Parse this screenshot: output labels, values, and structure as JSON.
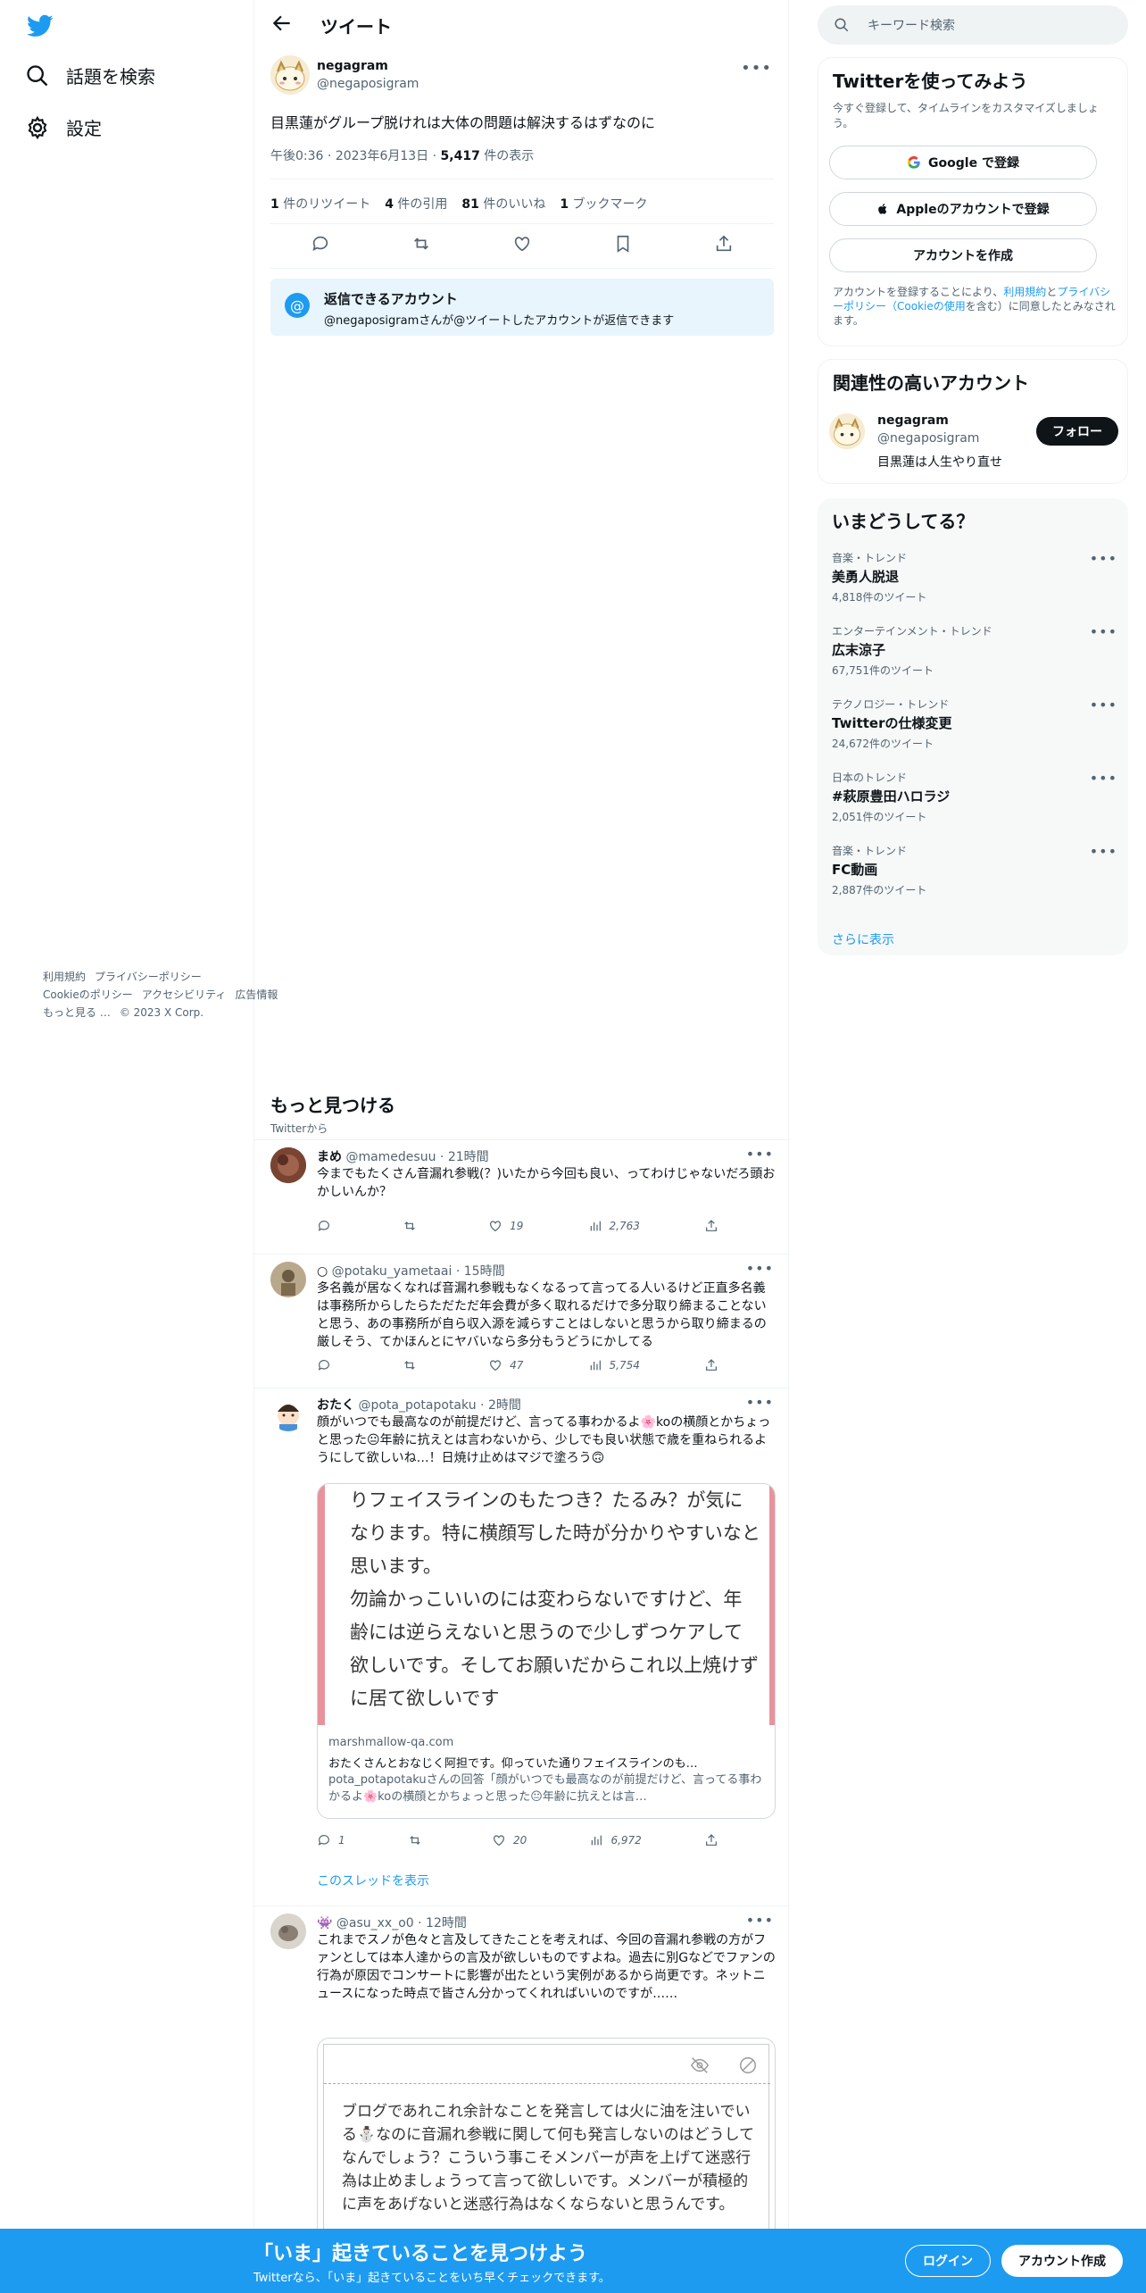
{
  "nav": {
    "explore_label": "話題を検索",
    "settings_label": "設定"
  },
  "header": {
    "title": "ツイート"
  },
  "tweet": {
    "name": "negagram",
    "handle": "@negaposigram",
    "text": "目黒蓮がグループ脱けれは大体の問題は解決するはずなのに",
    "time": "午後0:36",
    "date": "2023年6月13日",
    "views": "5,417",
    "views_label": "件の表示",
    "retweets": "1",
    "retweets_label": "件のリツイート",
    "quotes": "4",
    "quotes_label": "件の引用",
    "likes": "81",
    "likes_label": "件のいいね",
    "bookmarks": "1",
    "bookmarks_label": "ブックマーク"
  },
  "reply_notice": {
    "title": "返信できるアカウント",
    "body": "@negaposigramさんが@ツイートしたアカウントが返信できます"
  },
  "discover": {
    "title": "もっと見つける",
    "subtitle": "Twitterから"
  },
  "posts": [
    {
      "name": "まめ",
      "handle": "@mamedesuu",
      "time": "21時間",
      "text": "今までもたくさん音漏れ参戦(？)いたから今回も良い、ってわけじゃないだろ頭おかしいんか？",
      "replies": "",
      "retweets": "",
      "likes": "19",
      "views": "2,763"
    },
    {
      "name": "○",
      "handle": "@potaku_yametaai",
      "time": "15時間",
      "text": "多名義が居なくなれば音漏れ参戦もなくなるって言ってる人いるけど正直多名義は事務所からしたらただただ年会費が多く取れるだけで多分取り締まることないと思う、あの事務所が自ら収入源を減らすことはしないと思うから取り締まるの厳しそう、てかほんとにヤバいなら多分もうどうにかしてる",
      "replies": "",
      "retweets": "",
      "likes": "47",
      "views": "5,754"
    },
    {
      "name": "おたく",
      "handle": "@pota_potapotaku",
      "time": "2時間",
      "text": "顔がいつでも最高なのが前提だけど、言ってる事わかるよ🌸koの横顔とかちょっと思った😐年齢に抗えとは言わないから、少しでも良い状態で歳を重ねられるようにして欲しいね…！日焼け止めはマジで塗ろう🙃",
      "replies": "1",
      "retweets": "",
      "likes": "20",
      "views": "6,972",
      "card": {
        "image_text": "りフェイスラインのもたつき？たるみ？が気になります。特に横顔写した時が分かりやすいなと思います。\n勿論かっこいいのには変わらないですけど、年齢には逆らえないと思うので少しずつケアして欲しいです。そしてお願いだからこれ以上焼けずに居て欲しいです",
        "domain": "marshmallow-qa.com",
        "title": "おたくさんとおなじく阿担です。仰っていた通りフェイスラインのも…",
        "desc": "pota_potapotakuさんの回答「顔がいつでも最高なのが前提だけど、言ってる事わかるよ🌸koの横顔とかちょっと思った😐年齢に抗えとは言…"
      },
      "thread_label": "このスレッドを表示"
    },
    {
      "name": "👾",
      "handle": "@asu_xx_o0",
      "time": "12時間",
      "text": "これまでスノが色々と言及してきたことを考えれば、今回の音漏れ参戦の方がファンとしては本人達からの言及が欲しいものですよね。過去に別Gなどでファンの行為が原因でコンサートに影響が出たという実例があるから尚更です。ネットニュースになった時点で皆さん分かってくれればいいのですが……",
      "card_text": "ブログであれこれ余計なことを発言しては火に油を注いでいる⛄なのに音漏れ参戦に関して何も発言しないのはどうしてなんでしょう？こういう事こそメンバーが声を上げて迷惑行為は止めましょうって言って欲しいです。メンバーが積極的に声をあげないと迷惑行為はなくならないと思うんです。"
    }
  ],
  "search": {
    "placeholder": "キーワード検索"
  },
  "signup": {
    "title": "Twitterを使ってみよう",
    "subtitle": "今すぐ登録して、タイムラインをカスタマイズしましょう。",
    "google_label": "Google で登録",
    "apple_label": "Appleのアカウントで登録",
    "create_label": "アカウントを作成",
    "terms_prefix": "アカウントを登録することにより、",
    "terms_link1": "利用規約",
    "terms_and": "と",
    "terms_link2": "プライバシーポリシー",
    "terms_link3": "（Cookieの使用",
    "terms_suffix": "を含む）に同意したとみなされます。"
  },
  "related": {
    "title": "関連性の高いアカウント",
    "name": "negagram",
    "handle": "@negaposigram",
    "bio": "目黒蓮は人生やり直せ",
    "follow_label": "フォロー"
  },
  "trends": {
    "title": "いまどうしてる？",
    "items": [
      {
        "category": "音楽・トレンド",
        "name": "美勇人脱退",
        "count": "4,818件のツイート"
      },
      {
        "category": "エンターテインメント・トレンド",
        "name": "広末涼子",
        "count": "67,751件のツイート"
      },
      {
        "category": "テクノロジー・トレンド",
        "name": "Twitterの仕様変更",
        "count": "24,672件のツイート"
      },
      {
        "category": "日本のトレンド",
        "name": "#萩原豊田ハロラジ",
        "count": "2,051件のツイート"
      },
      {
        "category": "音楽・トレンド",
        "name": "FC動画",
        "count": "2,887件のツイート"
      }
    ],
    "show_more": "さらに表示"
  },
  "footer": {
    "links": [
      "利用規約",
      "プライバシーポリシー",
      "Cookieのポリシー",
      "アクセシビリティ",
      "広告情報",
      "もっと見る …"
    ],
    "copyright": "© 2023 X Corp."
  },
  "bottom_bar": {
    "title": "「いま」起きていることを見つけよう",
    "subtitle": "Twitterなら、「いま」起きていることをいち早くチェックできます。",
    "login_label": "ログイン",
    "create_label": "アカウント作成"
  },
  "colors": {
    "accent": "#1d9bf0",
    "text": "#0f1419",
    "secondary": "#536471",
    "card_border": "#e8939b"
  }
}
